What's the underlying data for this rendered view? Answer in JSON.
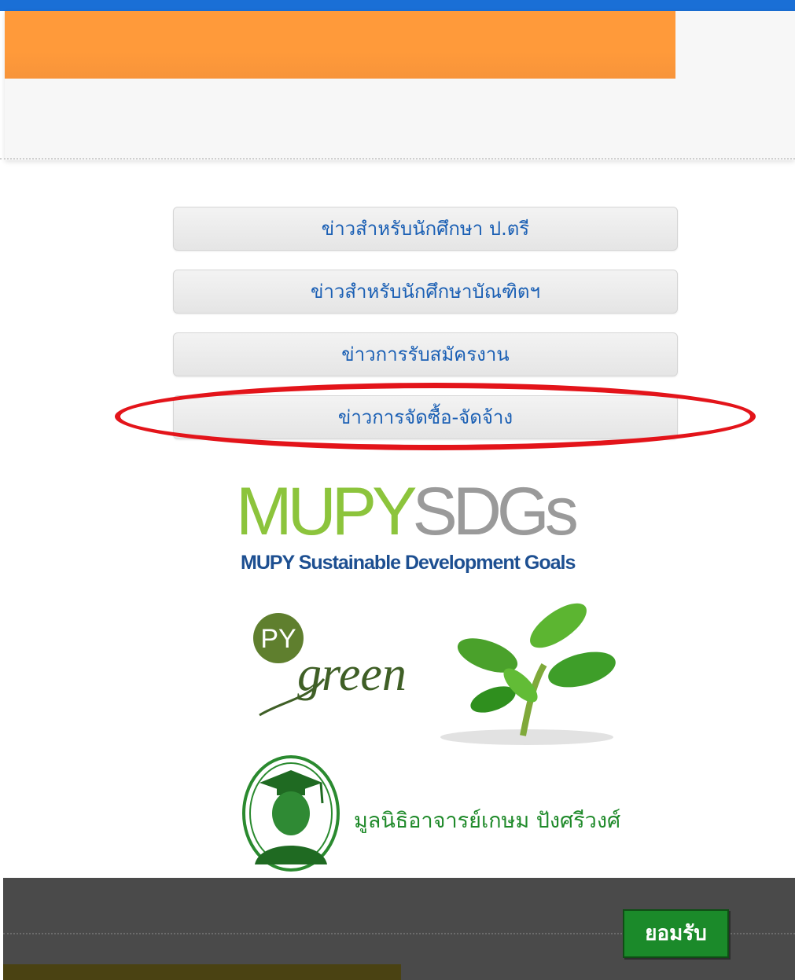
{
  "menu": {
    "items": [
      {
        "label": "ข่าวสำหรับนักศึกษา ป.ตรี"
      },
      {
        "label": "ข่าวสำหรับนักศึกษาบัณฑิตฯ"
      },
      {
        "label": "ข่าวการรับสมัครงาน"
      },
      {
        "label": "ข่าวการจัดซื้อ-จัดจ้าง"
      }
    ]
  },
  "sdg_logo": {
    "part1": "MUPY",
    "part2": "SDGs",
    "subtitle": "MUPY Sustainable Development Goals"
  },
  "green_logo": {
    "badge": "PY",
    "word": "green"
  },
  "foundation": {
    "name": "มูลนิธิอาจารย์เกษม ปังศรีวงศ์",
    "seal_text": "มูลนิธิอาจารย์เกษม ปังศรีวงศ์"
  },
  "cookie_bar": {
    "accept_label": "ยอมรับ"
  },
  "colors": {
    "top_blue": "#1a6fd6",
    "orange": "#ff9a3a",
    "link_blue": "#1a5fb4",
    "highlight_red": "#e3141a",
    "accept_green": "#1b8a2a",
    "cookie_bg": "#4a4a4a"
  }
}
